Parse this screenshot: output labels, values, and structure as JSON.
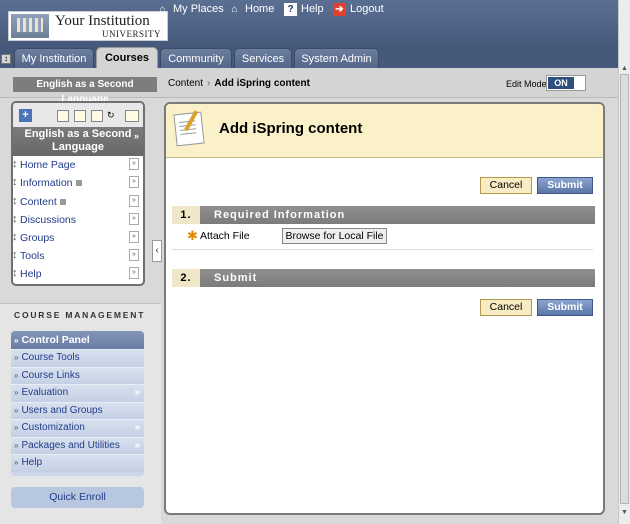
{
  "header": {
    "institution_name": "Your Institution",
    "institution_sub": "UNIVERSITY",
    "links": [
      {
        "label": "My Places",
        "icon": "house-icon"
      },
      {
        "label": "Home",
        "icon": "home-icon"
      },
      {
        "label": "Help",
        "icon": "help-icon"
      },
      {
        "label": "Logout",
        "icon": "logout-icon"
      }
    ]
  },
  "tabs": [
    {
      "label": "My Institution",
      "active": false
    },
    {
      "label": "Courses",
      "active": true
    },
    {
      "label": "Community",
      "active": false
    },
    {
      "label": "Services",
      "active": false
    },
    {
      "label": "System Admin",
      "active": false
    }
  ],
  "breadcrumb": {
    "course": "English as a Second Language",
    "items": [
      "Content",
      "Add iSpring content"
    ],
    "edit_mode_label": "Edit Mode:",
    "edit_mode_value": "ON"
  },
  "course_menu": {
    "title": "English as a Second Language",
    "items": [
      {
        "label": "Home Page"
      },
      {
        "label": "Information"
      },
      {
        "label": "Content"
      },
      {
        "label": "Discussions"
      },
      {
        "label": "Groups"
      },
      {
        "label": "Tools"
      },
      {
        "label": "Help"
      }
    ]
  },
  "course_management": {
    "title": "COURSE MANAGEMENT",
    "control_panel": "Control Panel",
    "items": [
      {
        "label": "Course Tools"
      },
      {
        "label": "Course Links"
      },
      {
        "label": "Evaluation"
      },
      {
        "label": "Users and Groups"
      },
      {
        "label": "Customization"
      },
      {
        "label": "Packages and Utilities"
      },
      {
        "label": "Help"
      }
    ],
    "quick_enroll": "Quick Enroll"
  },
  "main": {
    "title": "Add iSpring content",
    "cancel_label": "Cancel",
    "submit_label": "Submit",
    "sections": [
      {
        "number": "1.",
        "title": "Required Information"
      },
      {
        "number": "2.",
        "title": "Submit"
      }
    ],
    "attach_label": "Attach File",
    "browse_label": "Browse for Local File"
  },
  "colors": {
    "header_bg": "#46597b",
    "panel_header_bg": "#fbf1c9",
    "section_bg": "#808080",
    "submit_bg": "#5a75a8",
    "required_star": "#e08a00"
  }
}
